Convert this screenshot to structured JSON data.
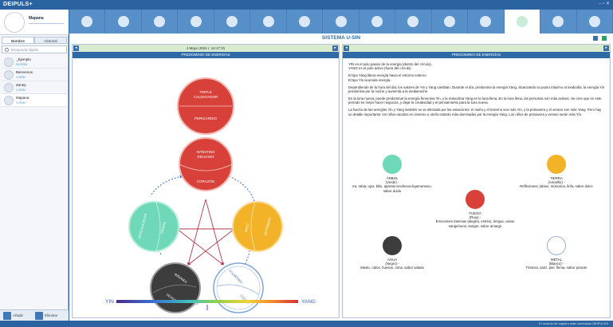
{
  "app": {
    "title": "DEIPULS+",
    "window_controls": "– ▫ ✕"
  },
  "sidebar": {
    "profile_name": "Mapana",
    "tabs": [
      "Nombre",
      "Historial"
    ],
    "search_placeholder": "Búsqueda rápida",
    "users": [
      {
        "name": "_Ejemplo",
        "sub": "26 RSN"
      },
      {
        "name": "Bienvenos",
        "sub": "1 RSN"
      },
      {
        "name": "Zanep",
        "sub": "1 RSN"
      },
      {
        "name": "Mapana",
        "sub": "1 RSN"
      }
    ],
    "add_label": "Añadir",
    "delete_label": "Eliminar"
  },
  "iconbar": {
    "items": [
      "heart-icon",
      "balance-icon",
      "fingerprint-icon",
      "shield-icon",
      "yoga-icon",
      "liver-icon",
      "lungs-icon",
      "spine-icon",
      "monitor-icon",
      "meditation-icon",
      "energy-circle-icon",
      "yin-yang-icon",
      "star-icon",
      "chart-icon",
      "infinity-icon"
    ],
    "active_index": 12
  },
  "main": {
    "system_title": "SISTEMA U-SIN",
    "left": {
      "date": "4 Mayo 2024 r. 14:17:31",
      "header": "PREDOMINIO DE ENERGÍAS",
      "circles": {
        "top": {
          "line1": "TRIPLE",
          "line2": "CALENTADOR",
          "bottom": "PERICARDIO"
        },
        "fire": {
          "line1": "INTESTINO",
          "line2": "DELGADO",
          "bottom": "CORAZÓN"
        },
        "earth": {
          "top": "BAZO",
          "side": "ESTÓMAGO"
        },
        "metal": {
          "top": "PULMONES",
          "side": "COLON"
        },
        "water": {
          "top": "RIÑONES",
          "side": "VEJIGA"
        },
        "wood": {
          "top": "VESÍCULA BILIAR",
          "side": "HÍGADO"
        }
      },
      "yin_label": "YIN",
      "yang_label": "YANG"
    },
    "right": {
      "header": "PREDOMINIO DE ENERGÍAS",
      "paragraphs": [
        "YIN es el polo pasivo de la energía (dentro del círculo).\nYANG es el polo activo (fuera del círculo).",
        "El tipo Yang libera energía hacia el entorno externo.\nEl tipo Yin acumula energía.",
        "Dependiendo de la hora del día, los valores de Yin y Yang cambian. Durante el día, predomina la energía Yang, alcanzando su punto máximo al mediodía; la energía Yin predomina por la noche y aumenta a la medianoche.",
        "En la luna nueva, puede predominar la energía femenina Yin, y la masculina Yang en la luna llena. En la luna llena, las personas son más activas. Se cree que en este período es mejor hacer negocios, y dejar la creatividad y el pensamiento para la luna nueva.",
        "La fuerza de las energías Yin y Yang también se ve afectada por las estaciones: el otoño y el invierno son más Yin, y la primavera y el verano son más Yang. Pero hay un detalle importante: los niños nacidos en invierno u otoño estarán más dominados por la energía Yang. Los niños de primavera y verano serán más Yin."
      ],
      "elements": [
        {
          "title": "ÁRBOL",
          "color_name": "(Verde) -",
          "desc": "Ira, rabia; ojos, bilis, aparato tendinoso-ligamentoso, sabor ácido",
          "color": "#6fd8b8"
        },
        {
          "title": "TIERRA",
          "color_name": "(Amarillo) -",
          "desc": "Reflexiones; labios, músculos, linfa, sabor dulce",
          "color": "#f2b328"
        },
        {
          "title": "FUEGO",
          "color_name": "(Rojo) -",
          "desc": "Emociones intensas (alegría, estrés), lengua, vasos sanguíneos, sangre, sabor amargo",
          "color": "#d8403a"
        },
        {
          "title": "AGUA",
          "color_name": "(Negro) -",
          "desc": "Miedo, oídos, huesos, orina, sabor salado",
          "color": "#3d3d3d"
        },
        {
          "title": "METAL",
          "color_name": "(Blanco) -",
          "desc": "Tristeza, nariz, piel, flema, sabor picante",
          "color": "#ffffff"
        }
      ]
    }
  },
  "footer": {
    "status": "El módulo de registro está conectado DEIPULSS"
  },
  "colors": {
    "accent": "#2f6aa7",
    "fire": "#d8403a",
    "earth": "#f2b328",
    "wood": "#6fd8b8",
    "water": "#3d3d3d"
  }
}
